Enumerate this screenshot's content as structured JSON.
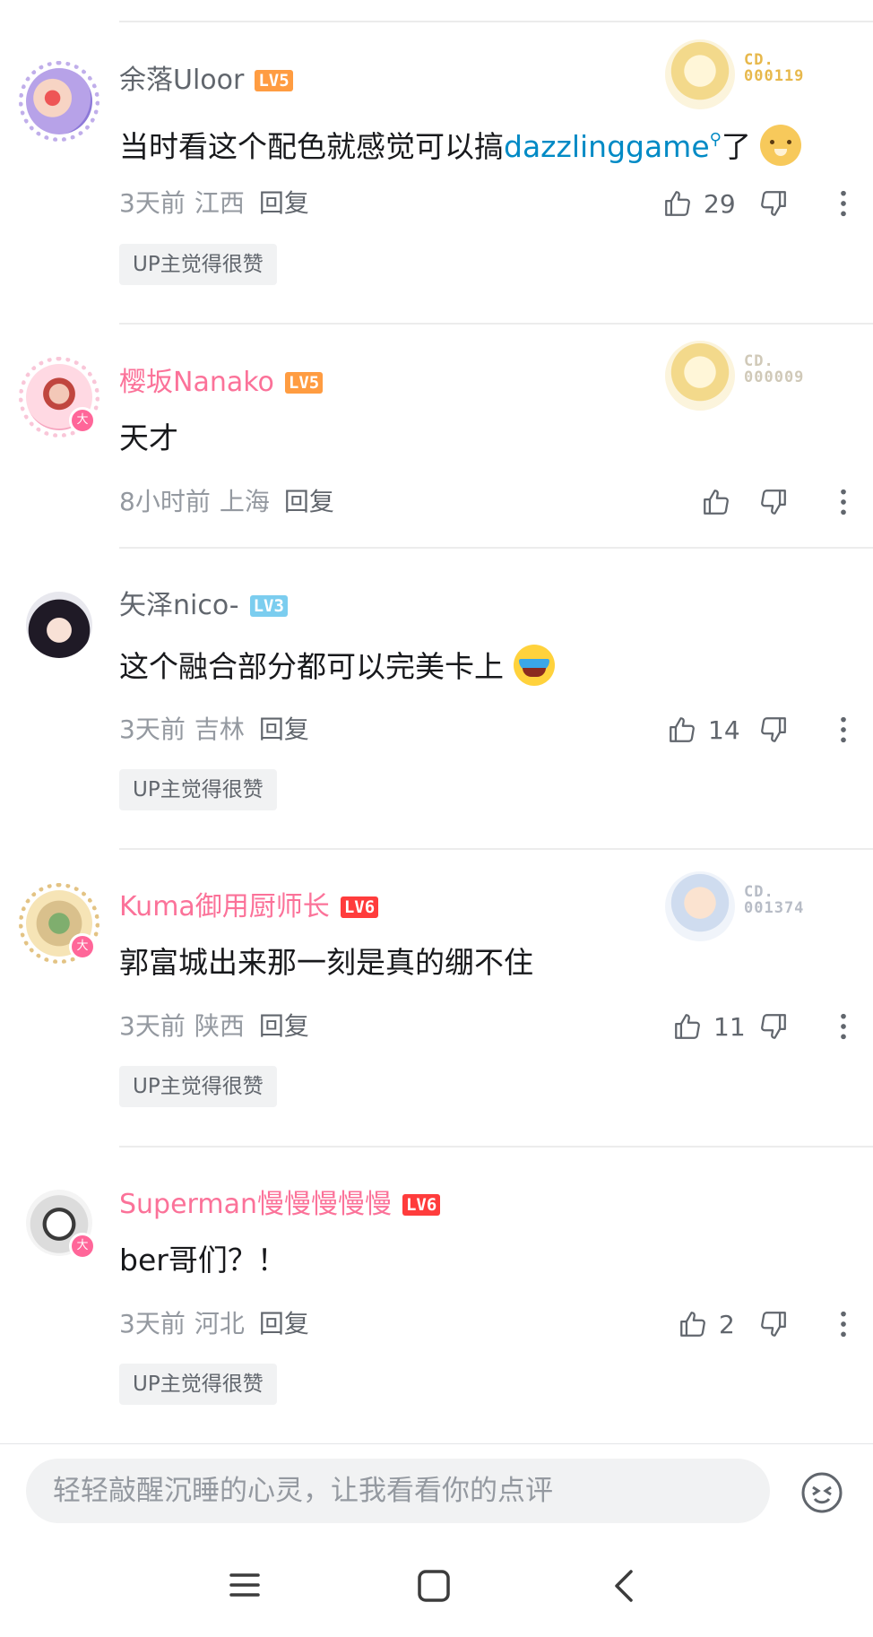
{
  "colors": {
    "vip_name": "#fb7299",
    "normal_name": "#61666d",
    "link": "#008ac5",
    "meta": "#9499a0",
    "lv5": "#ff9c41",
    "lv6": "#ff3c3c",
    "lv3": "#7bcdef"
  },
  "comments": [
    {
      "user": "余落Uloor",
      "level": "LV5",
      "fan_no": "CD.\n000119",
      "text_before": "当时看这个配色就感觉可以搞",
      "link": "dazzlinggame",
      "text_after": "了",
      "emoji": "dog-emoji",
      "time": "3天前",
      "location": "江西",
      "reply": "回复",
      "likes": "29",
      "tag": "UP主觉得很赞"
    },
    {
      "user": "樱坂Nanako",
      "level": "LV5",
      "fan_no": "CD.\n000009",
      "text": "天才",
      "time": "8小时前",
      "location": "上海",
      "reply": "回复",
      "likes": ""
    },
    {
      "user": "矢泽nico-",
      "level": "LV3",
      "text": "这个融合部分都可以完美卡上",
      "emoji": "laugh-cry-emoji",
      "time": "3天前",
      "location": "吉林",
      "reply": "回复",
      "likes": "14",
      "tag": "UP主觉得很赞"
    },
    {
      "user": "Kuma御用厨师长",
      "level": "LV6",
      "fan_no": "CD.\n001374",
      "text": "郭富城出来那一刻是真的绷不住",
      "time": "3天前",
      "location": "陕西",
      "reply": "回复",
      "likes": "11",
      "tag": "UP主觉得很赞"
    },
    {
      "user": "Superman慢慢慢慢慢",
      "level": "LV6",
      "text": "ber哥们？！",
      "time": "3天前",
      "location": "河北",
      "reply": "回复",
      "likes": "2",
      "tag": "UP主觉得很赞"
    }
  ],
  "vip_badge": "大",
  "input": {
    "placeholder": "轻轻敲醒沉睡的心灵，让我看看你的点评"
  },
  "icons": [
    "thumb-up-icon",
    "thumb-down-icon",
    "more-vertical-icon",
    "emoji-icon",
    "menu-icon",
    "home-icon",
    "back-icon",
    "search-icon"
  ]
}
